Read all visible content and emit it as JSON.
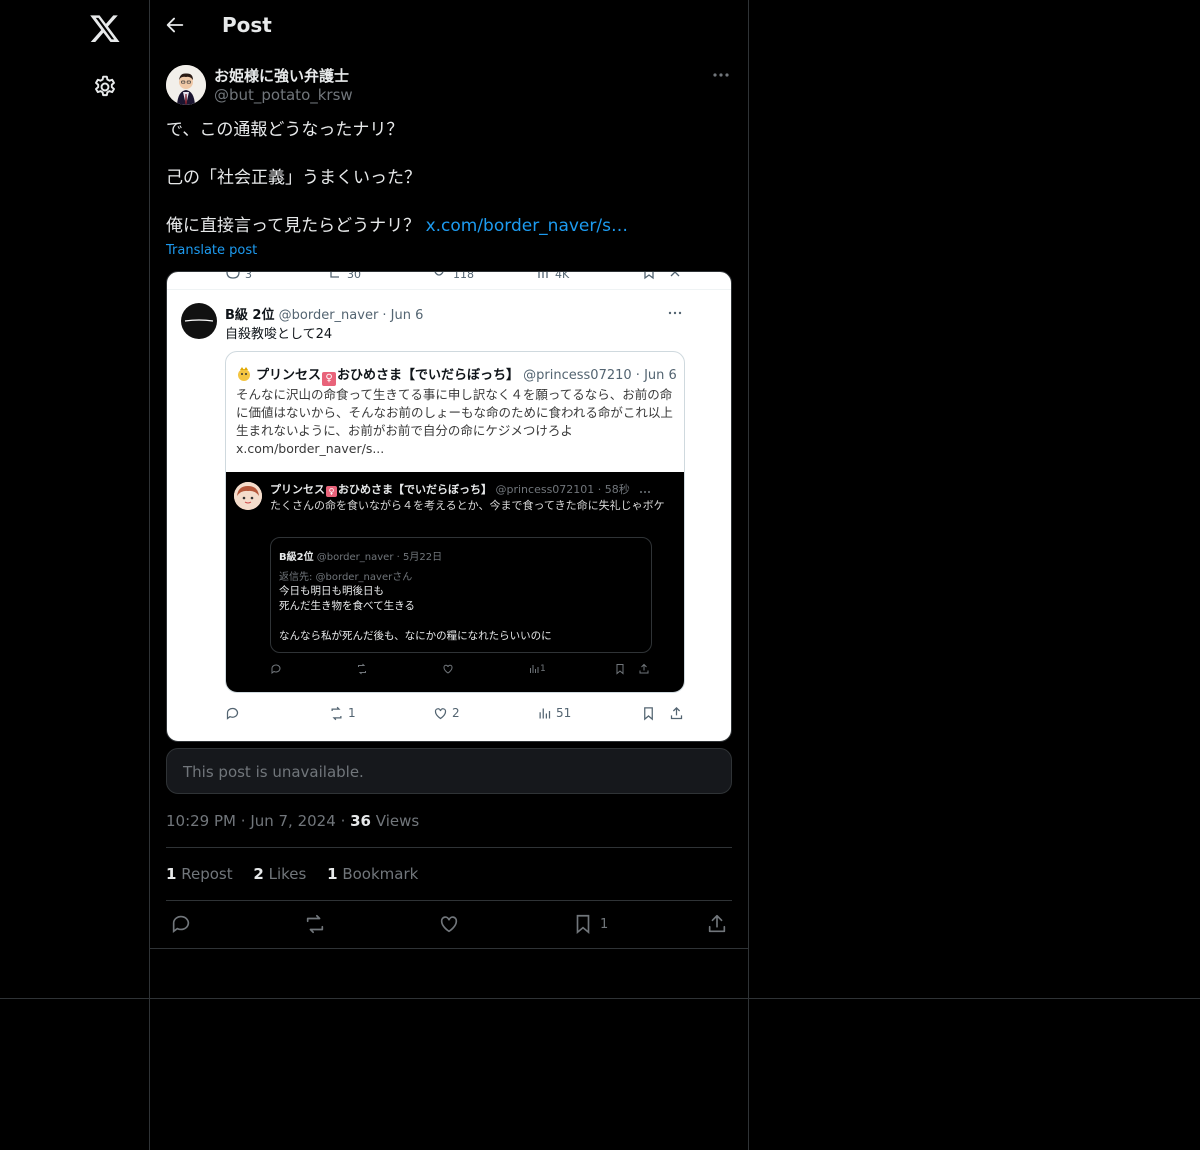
{
  "nav": {
    "logo": "x-logo-icon",
    "settings": "gear-icon"
  },
  "header": {
    "back": "back-arrow-icon",
    "title": "Post"
  },
  "post": {
    "author_name": "お姫様に強い弁護士",
    "author_handle": "@but_potato_krsw",
    "text_lines": [
      "で、この通報どうなったナリ？",
      "己の「社会正義」うまくいった？",
      "俺に直接言って見たらどうナリ？ "
    ],
    "link_text": "x.com/border_naver/s…",
    "translate_label": "Translate post",
    "time": "10:29 PM",
    "date": "Jun 7, 2024",
    "views_count": "36",
    "views_label": "Views",
    "repost_count": "1",
    "repost_label": "Repost",
    "likes_count": "2",
    "likes_label": "Likes",
    "bookmark_count": "1",
    "bookmark_label": "Bookmark",
    "action_bookmark_count": "1",
    "unavailable_text": "This post is unavailable."
  },
  "screenshot": {
    "top_partial": [
      "3",
      "30",
      "118",
      "4K"
    ],
    "tweet": {
      "name": "B級 2位",
      "handle_date": "@border_naver · Jun 6",
      "text": "自殺教唆として24"
    },
    "quote1": {
      "name_a": "プリンセス",
      "name_b": "おひめさま【でいだらぼっち】",
      "handle_date": "@princess07210 · Jun 6",
      "body": "そんなに沢山の命食って生きてる事に申し訳なく４を願ってるなら、お前の命に価値はないから、そんなお前のしょーもな命のために食われる命がこれ以上生まれないように、お前がお前で自分の命にケジメつけろよ x.com/border_naver/s..."
    },
    "quote2": {
      "name_a": "プリンセス",
      "name_b": "おひめさま【でいだらぼっち】",
      "handle_date": "@princess072101 · 58秒",
      "body": "たくさんの命を食いながら４を考えるとか、今まで食ってきた命に失礼じゃボケ"
    },
    "quote3": {
      "name": "B級2位",
      "handle_date": "@border_naver · 5月22日",
      "reply_to": "返信先: @border_naverさん",
      "line1": "今日も明日も明後日も",
      "line2": "死んだ生き物を食べて生きる",
      "line3": "なんなら私が死んだ後も、なにかの糧になれたらいいのに"
    },
    "q2_views": "1",
    "actions": {
      "retweets": "1",
      "likes": "2",
      "views": "51"
    }
  }
}
